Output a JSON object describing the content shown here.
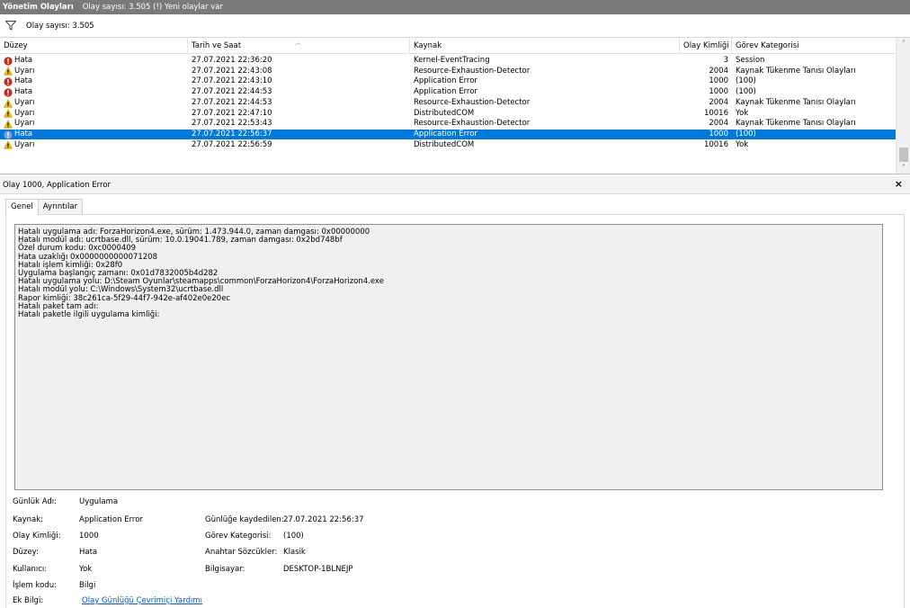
{
  "titlebar": {
    "title": "Yönetim Olayları",
    "subtitle": "Olay sayısı: 3.505 (!) Yeni olaylar var"
  },
  "filter": {
    "icon": "filter-icon",
    "text": "Olay sayısı: 3.505"
  },
  "grid": {
    "columns": [
      "Düzey",
      "Tarih ve Saat",
      "Kaynak",
      "Olay Kimliği",
      "Görev Kategorisi"
    ],
    "rows": [
      {
        "level": "Hata",
        "icon": "error-icon",
        "date": "27.07.2021 22:36:20",
        "source": "Kernel-EventTracing",
        "id": "3",
        "category": "Session"
      },
      {
        "level": "Uyarı",
        "icon": "warning-icon",
        "date": "27.07.2021 22:43:08",
        "source": "Resource-Exhaustion-Detector",
        "id": "2004",
        "category": "Kaynak Tükenme Tanısı Olayları"
      },
      {
        "level": "Hata",
        "icon": "error-icon",
        "date": "27.07.2021 22:43:10",
        "source": "Application Error",
        "id": "1000",
        "category": "(100)"
      },
      {
        "level": "Hata",
        "icon": "error-icon",
        "date": "27.07.2021 22:44:53",
        "source": "Application Error",
        "id": "1000",
        "category": "(100)"
      },
      {
        "level": "Uyarı",
        "icon": "warning-icon",
        "date": "27.07.2021 22:44:53",
        "source": "Resource-Exhaustion-Detector",
        "id": "2004",
        "category": "Kaynak Tükenme Tanısı Olayları"
      },
      {
        "level": "Uyarı",
        "icon": "warning-icon",
        "date": "27.07.2021 22:47:10",
        "source": "DistributedCOM",
        "id": "10016",
        "category": "Yok"
      },
      {
        "level": "Uyarı",
        "icon": "warning-icon",
        "date": "27.07.2021 22:53:43",
        "source": "Resource-Exhaustion-Detector",
        "id": "2004",
        "category": "Kaynak Tükenme Tanısı Olayları"
      },
      {
        "level": "Hata",
        "icon": "error-icon",
        "date": "27.07.2021 22:56:37",
        "source": "Application Error",
        "id": "1000",
        "category": "(100)",
        "selected": true
      },
      {
        "level": "Uyarı",
        "icon": "warning-icon",
        "date": "27.07.2021 22:56:59",
        "source": "DistributedCOM",
        "id": "10016",
        "category": "Yok"
      }
    ]
  },
  "detail": {
    "header": "Olay 1000, Application Error",
    "close_label": "×",
    "tabs": [
      "Genel",
      "Ayrıntılar"
    ],
    "active_tab": "Genel",
    "message_lines": [
      "Hatalı uygulama adı: ForzaHorizon4.exe, sürüm: 1.473.944.0, zaman damgası: 0x00000000",
      "Hatalı modül adı: ucrtbase.dll, sürüm: 10.0.19041.789, zaman damgası: 0x2bd748bf",
      "Özel durum kodu: 0xc0000409",
      "Hata uzaklığı 0x0000000000071208",
      "Hatalı işlem kimliği: 0x28f0",
      "Uygulama başlangıç zamanı: 0x01d7832005b4d282",
      "Hatalı uygulama yolu: D:\\Steam Oyunlar\\steamapps\\common\\ForzaHorizon4\\ForzaHorizon4.exe",
      "Hatalı modül yolu: C:\\Windows\\System32\\ucrtbase.dll",
      "Rapor kimliği: 38c261ca-5f29-44f7-942e-af402e0e20ec",
      "Hatalı paket tam adı:",
      "Hatalı paketle ilgili uygulama kimliği:"
    ],
    "props": {
      "log_name_label": "Günlük Adı:",
      "log_name": "Uygulama",
      "source_label": "Kaynak:",
      "source": "Application Error",
      "logged_label": "Günlüğe kaydedilen:",
      "logged": "27.07.2021 22:56:37",
      "event_id_label": "Olay Kimliği:",
      "event_id": "1000",
      "task_label": "Görev Kategorisi:",
      "task": "(100)",
      "level_label": "Düzey:",
      "level": "Hata",
      "keywords_label": "Anahtar Sözcükler:",
      "keywords": "Klasik",
      "user_label": "Kullanıcı:",
      "user": "Yok",
      "computer_label": "Bilgisayar:",
      "computer": "DESKTOP-1BLNEJP",
      "opcode_label": "İşlem kodu:",
      "opcode": "Bilgi",
      "more_label": "Ek Bilgi:",
      "more_link": "Olay Günlüğü Çevrimiçi Yardımı"
    }
  }
}
